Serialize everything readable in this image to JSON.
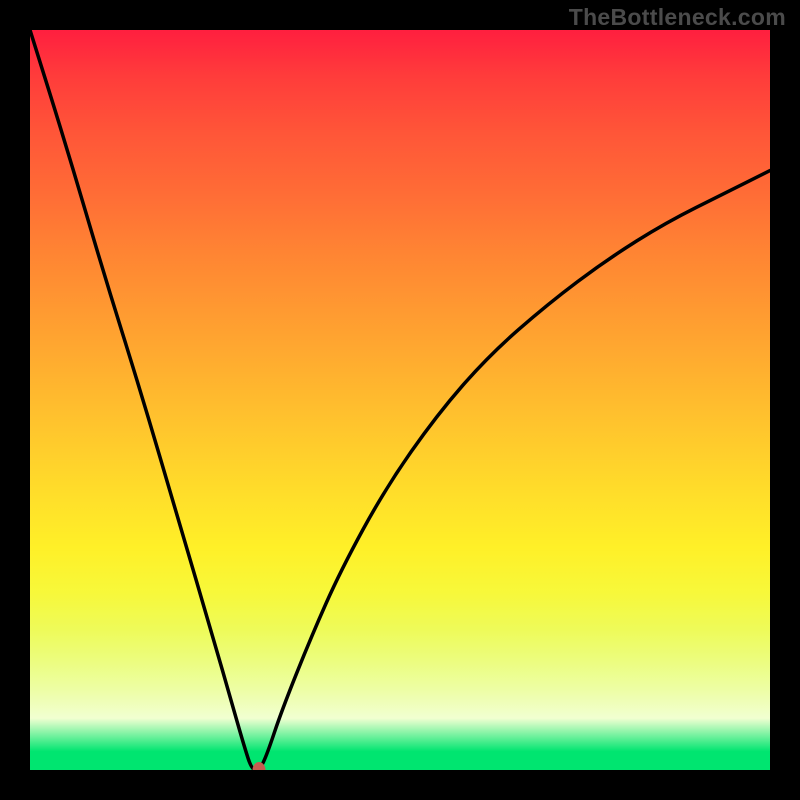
{
  "watermark": "TheBottleneck.com",
  "chart_data": {
    "type": "line",
    "title": "",
    "xlabel": "",
    "ylabel": "",
    "xlim": [
      0,
      100
    ],
    "ylim": [
      0,
      100
    ],
    "grid": false,
    "legend": false,
    "background": "red-yellow-green vertical gradient",
    "series": [
      {
        "name": "bottleneck-curve",
        "x": [
          0,
          5,
          10,
          15,
          20,
          25,
          27,
          29,
          30,
          31,
          32,
          34,
          38,
          42,
          48,
          55,
          62,
          70,
          78,
          86,
          94,
          100
        ],
        "y": [
          100,
          84,
          67,
          51,
          34,
          17,
          10,
          3,
          0,
          0,
          2,
          8,
          18,
          27,
          38,
          48,
          56,
          63,
          69,
          74,
          78,
          81
        ]
      }
    ],
    "marker": {
      "x": 31,
      "y": 0,
      "color": "#c65d50"
    },
    "colors": {
      "curve": "#000000",
      "gradient_top": "#ff1f3f",
      "gradient_mid": "#ffdc2a",
      "gradient_bottom": "#00e570"
    }
  }
}
